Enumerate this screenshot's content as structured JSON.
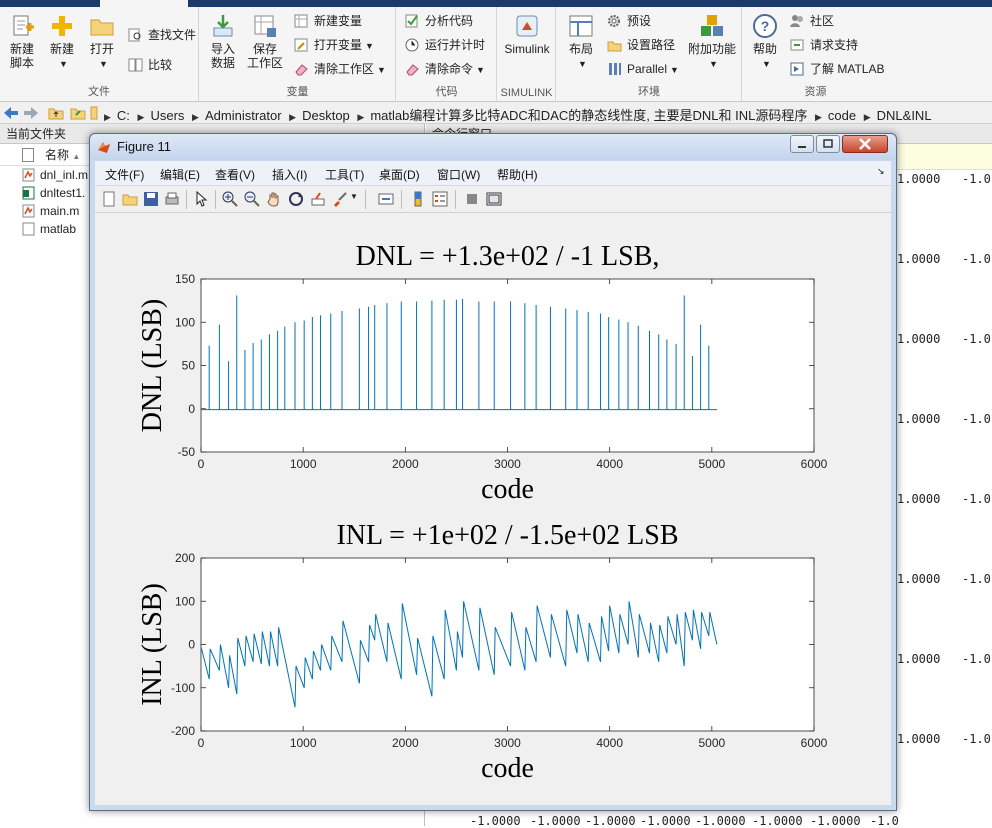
{
  "toolstrip": {
    "groups": {
      "file": "文件",
      "variable": "变量",
      "code": "代码",
      "simulink": "SIMULINK",
      "environment": "环境",
      "resources": "资源"
    },
    "new_script": [
      "新建",
      "脚本"
    ],
    "new": "新建",
    "open": "打开",
    "find_files": "查找文件",
    "compare": "比较",
    "import": [
      "导入",
      "数据"
    ],
    "save_ws": [
      "保存",
      "工作区"
    ],
    "new_variable": "新建变量",
    "open_variable": "打开变量",
    "clear_workspace": "清除工作区",
    "analyze_code": "分析代码",
    "run_timing": "运行并计时",
    "clear_commands": "清除命令",
    "simulink": "Simulink",
    "layout": "布局",
    "preferences": "预设",
    "set_path": "设置路径",
    "parallel": "Parallel",
    "addons": "附加功能",
    "help": "帮助",
    "community": "社区",
    "request_support": "请求支持",
    "learn_matlab": "了解 MATLAB"
  },
  "address": {
    "path": [
      "C:",
      "Users",
      "Administrator",
      "Desktop",
      "matlab编程计算多比特ADC和DAC的静态线性度, 主要是DNL和 INL源码程序",
      "code",
      "DNL&INL"
    ]
  },
  "file_browser": {
    "title": "当前文件夹",
    "column": "名称",
    "files": [
      "dnl_inl.m",
      "dnltest1.",
      "main.m",
      "matlab"
    ]
  },
  "command_window": {
    "title": "命令行窗口",
    "values": [
      "1.0000",
      "-1.0"
    ],
    "bottom_values": [
      "-1.0000",
      "-1.0000",
      "-1.0000",
      "-1.0000",
      "-1.0000",
      "-1.0000",
      "-1.0000",
      "-1.0"
    ]
  },
  "figure": {
    "title": "Figure 11",
    "menus": [
      "文件(F)",
      "编辑(E)",
      "查看(V)",
      "插入(I)",
      "工具(T)",
      "桌面(D)",
      "窗口(W)",
      "帮助(H)"
    ]
  },
  "chart_data": [
    {
      "type": "line",
      "title": "DNL = +1.3e+02 / -1 LSB,",
      "xlabel": "code",
      "ylabel": "DNL (LSB)",
      "xlim": [
        0,
        6000
      ],
      "ylim": [
        -50,
        150
      ],
      "xticks": [
        0,
        1000,
        2000,
        3000,
        4000,
        5000,
        6000
      ],
      "yticks": [
        -50,
        0,
        50,
        100,
        150
      ],
      "series_color": "#0072bd",
      "baseline": -1,
      "x_end": 5050,
      "spikes": [
        [
          80,
          73
        ],
        [
          180,
          97
        ],
        [
          270,
          55
        ],
        [
          350,
          131
        ],
        [
          430,
          68
        ],
        [
          510,
          76
        ],
        [
          590,
          80
        ],
        [
          670,
          86
        ],
        [
          750,
          90
        ],
        [
          820,
          95
        ],
        [
          920,
          100
        ],
        [
          1010,
          102
        ],
        [
          1090,
          106
        ],
        [
          1170,
          108
        ],
        [
          1270,
          110
        ],
        [
          1380,
          113
        ],
        [
          1550,
          116
        ],
        [
          1640,
          118
        ],
        [
          1700,
          120
        ],
        [
          1820,
          122
        ],
        [
          1960,
          124
        ],
        [
          2110,
          124
        ],
        [
          2260,
          125
        ],
        [
          2380,
          126
        ],
        [
          2500,
          126
        ],
        [
          2560,
          127
        ],
        [
          2720,
          124
        ],
        [
          2870,
          124
        ],
        [
          3030,
          124
        ],
        [
          3170,
          122
        ],
        [
          3280,
          120
        ],
        [
          3420,
          118
        ],
        [
          3570,
          116
        ],
        [
          3680,
          114
        ],
        [
          3790,
          112
        ],
        [
          3910,
          110
        ],
        [
          3990,
          106
        ],
        [
          4090,
          103
        ],
        [
          4180,
          100
        ],
        [
          4280,
          96
        ],
        [
          4390,
          90
        ],
        [
          4480,
          86
        ],
        [
          4560,
          80
        ],
        [
          4650,
          75
        ],
        [
          4730,
          131
        ],
        [
          4810,
          61
        ],
        [
          4890,
          97
        ],
        [
          4970,
          73
        ]
      ]
    },
    {
      "type": "line",
      "title": "INL = +1e+02 / -1.5e+02 LSB",
      "xlabel": "code",
      "ylabel": "INL (LSB)",
      "xlim": [
        0,
        6000
      ],
      "ylim": [
        -200,
        200
      ],
      "xticks": [
        0,
        1000,
        2000,
        3000,
        4000,
        5000,
        6000
      ],
      "yticks": [
        -200,
        -100,
        0,
        100,
        200
      ],
      "series_color": "#0072bd",
      "points": [
        [
          0,
          -5
        ],
        [
          80,
          -80
        ],
        [
          90,
          -10
        ],
        [
          180,
          -60
        ],
        [
          190,
          0
        ],
        [
          270,
          -100
        ],
        [
          280,
          -25
        ],
        [
          350,
          -115
        ],
        [
          360,
          15
        ],
        [
          430,
          -50
        ],
        [
          440,
          20
        ],
        [
          510,
          -40
        ],
        [
          520,
          25
        ],
        [
          590,
          -45
        ],
        [
          600,
          30
        ],
        [
          670,
          -50
        ],
        [
          680,
          30
        ],
        [
          750,
          -50
        ],
        [
          760,
          40
        ],
        [
          920,
          -145
        ],
        [
          930,
          -50
        ],
        [
          1010,
          -100
        ],
        [
          1020,
          -30
        ],
        [
          1090,
          -80
        ],
        [
          1100,
          -15
        ],
        [
          1170,
          -60
        ],
        [
          1180,
          0
        ],
        [
          1270,
          -60
        ],
        [
          1280,
          20
        ],
        [
          1380,
          -40
        ],
        [
          1390,
          55
        ],
        [
          1550,
          -90
        ],
        [
          1560,
          10
        ],
        [
          1640,
          -40
        ],
        [
          1650,
          45
        ],
        [
          1700,
          10
        ],
        [
          1710,
          70
        ],
        [
          1820,
          -40
        ],
        [
          1830,
          50
        ],
        [
          1960,
          -80
        ],
        [
          1970,
          95
        ],
        [
          2110,
          -70
        ],
        [
          2120,
          15
        ],
        [
          2260,
          -120
        ],
        [
          2270,
          20
        ],
        [
          2380,
          -80
        ],
        [
          2390,
          80
        ],
        [
          2500,
          -60
        ],
        [
          2510,
          30
        ],
        [
          2560,
          -30
        ],
        [
          2570,
          100
        ],
        [
          2720,
          -60
        ],
        [
          2730,
          85
        ],
        [
          2870,
          -70
        ],
        [
          2880,
          40
        ],
        [
          3030,
          -50
        ],
        [
          3040,
          75
        ],
        [
          3170,
          -60
        ],
        [
          3180,
          40
        ],
        [
          3280,
          -40
        ],
        [
          3290,
          90
        ],
        [
          3420,
          -30
        ],
        [
          3430,
          70
        ],
        [
          3570,
          -50
        ],
        [
          3580,
          80
        ],
        [
          3680,
          -20
        ],
        [
          3690,
          70
        ],
        [
          3790,
          -40
        ],
        [
          3800,
          50
        ],
        [
          3910,
          -40
        ],
        [
          3920,
          65
        ],
        [
          3990,
          -15
        ],
        [
          4000,
          90
        ],
        [
          4090,
          -20
        ],
        [
          4100,
          70
        ],
        [
          4180,
          0
        ],
        [
          4190,
          100
        ],
        [
          4280,
          -30
        ],
        [
          4290,
          70
        ],
        [
          4390,
          -20
        ],
        [
          4400,
          50
        ],
        [
          4480,
          -40
        ],
        [
          4490,
          45
        ],
        [
          4560,
          -20
        ],
        [
          4570,
          65
        ],
        [
          4650,
          0
        ],
        [
          4660,
          70
        ],
        [
          4730,
          -50
        ],
        [
          4740,
          75
        ],
        [
          4810,
          10
        ],
        [
          4820,
          80
        ],
        [
          4890,
          -10
        ],
        [
          4900,
          75
        ],
        [
          4970,
          20
        ],
        [
          4980,
          75
        ],
        [
          5050,
          0
        ]
      ]
    }
  ]
}
